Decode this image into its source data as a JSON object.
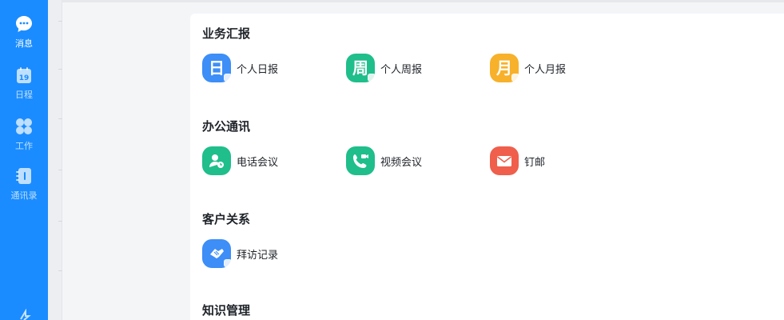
{
  "nav": {
    "items": [
      {
        "label": "消息",
        "icon": "chat-bubble-icon"
      },
      {
        "label": "日程",
        "icon": "calendar-icon",
        "icon_text": "19"
      },
      {
        "label": "工作",
        "icon": "apps-grid-icon"
      },
      {
        "label": "通讯录",
        "icon": "contacts-book-icon"
      }
    ],
    "bottom_icon": "expand-icon"
  },
  "sections": [
    {
      "title": "业务汇报",
      "apps": [
        {
          "label": "个人日报",
          "glyph": "日",
          "color": "#3d8ef7"
        },
        {
          "label": "个人周报",
          "glyph": "周",
          "color": "#1fbe8b"
        },
        {
          "label": "个人月报",
          "glyph": "月",
          "color": "#f7b12a"
        }
      ]
    },
    {
      "title": "办公通讯",
      "apps": [
        {
          "label": "电话会议",
          "glyph": "",
          "color": "#1fbe8b",
          "icon": "phone-conference-icon"
        },
        {
          "label": "视频会议",
          "glyph": "",
          "color": "#1fbe8b",
          "icon": "video-call-icon"
        },
        {
          "label": "钉邮",
          "glyph": "",
          "color": "#ef5f4c",
          "icon": "mail-icon"
        }
      ]
    },
    {
      "title": "客户关系",
      "apps": [
        {
          "label": "拜访记录",
          "glyph": "",
          "color": "#3d8ef7",
          "icon": "handshake-icon"
        }
      ]
    },
    {
      "title": "知识管理",
      "apps": []
    }
  ],
  "colors": {
    "nav_bg": "#1a8cff",
    "page_bg": "#f4f5f7",
    "panel_bg": "#ffffff"
  }
}
